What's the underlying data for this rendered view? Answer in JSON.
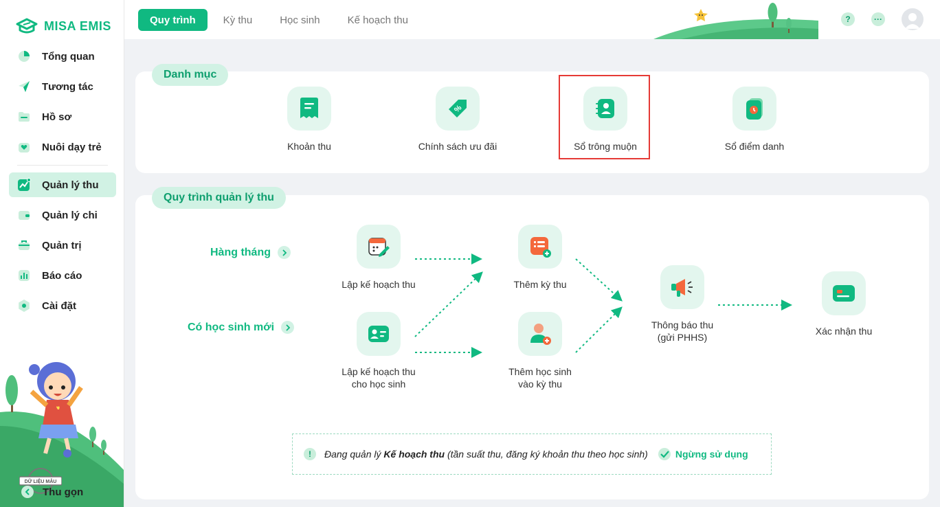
{
  "brand": {
    "name": "MISA EMIS"
  },
  "sidebar": {
    "items": [
      {
        "label": "Tổng quan",
        "icon": "pie-chart-icon"
      },
      {
        "label": "Tương tác",
        "icon": "paper-plane-icon"
      },
      {
        "label": "Hồ sơ",
        "icon": "folder-icon"
      },
      {
        "label": "Nuôi dạy trẻ",
        "icon": "heart-hand-icon"
      },
      {
        "label": "Quản lý thu",
        "icon": "trend-chart-icon",
        "active": true
      },
      {
        "label": "Quản lý chi",
        "icon": "wallet-icon"
      },
      {
        "label": "Quản trị",
        "icon": "briefcase-icon"
      },
      {
        "label": "Báo cáo",
        "icon": "bar-chart-icon"
      },
      {
        "label": "Cài đặt",
        "icon": "gear-icon"
      }
    ],
    "collapse_label": "Thu gọn",
    "stamp_text": "DỮ LIỆU MẪU"
  },
  "topbar": {
    "tabs": [
      {
        "label": "Quy trình",
        "active": true
      },
      {
        "label": "Kỳ thu"
      },
      {
        "label": "Học sinh"
      },
      {
        "label": "Kế hoạch thu"
      }
    ],
    "help_label": "?",
    "more_label": "···"
  },
  "catalog": {
    "title": "Danh mục",
    "items": [
      {
        "label": "Khoản thu",
        "icon": "receipt-icon"
      },
      {
        "label": "Chính sách ưu đãi",
        "icon": "discount-tag-icon"
      },
      {
        "label": "Sổ trông muộn",
        "icon": "contact-book-icon",
        "highlighted": true
      },
      {
        "label": "Sổ điểm danh",
        "icon": "attendance-clock-icon"
      }
    ]
  },
  "process": {
    "title": "Quy trình quản lý thu",
    "branches": [
      {
        "label": "Hàng tháng"
      },
      {
        "label": "Có học sinh mới"
      }
    ],
    "steps": {
      "plan": {
        "label": "Lập kế hoạch thu"
      },
      "plan_student_line1": "Lập kế hoạch thu",
      "plan_student_line2": "cho học sinh",
      "add_period": {
        "label": "Thêm kỳ thu"
      },
      "add_student_line1": "Thêm học sinh",
      "add_student_line2": "vào kỳ thu",
      "notify_line1": "Thông báo thu",
      "notify_line2": "(gửi PHHS)",
      "confirm": {
        "label": "Xác nhận thu"
      }
    },
    "notice": {
      "prefix": "Đang quản lý ",
      "emphasis": "Kế hoạch thu",
      "suffix": " (tần suất thu, đăng ký khoản thu theo học sinh)",
      "action": "Ngừng sử dụng"
    }
  },
  "colors": {
    "primary": "#10b981",
    "primary_light": "#d1f2e4",
    "tile_bg": "#e3f6ee",
    "highlight_border": "#e53935",
    "accent_orange": "#f4683c"
  }
}
